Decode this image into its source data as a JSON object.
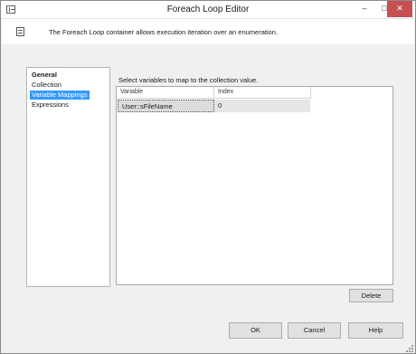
{
  "window": {
    "title": "Foreach Loop Editor",
    "minimize_glyph": "–",
    "maximize_glyph": "□",
    "close_glyph": "✕"
  },
  "header": {
    "description": "The Foreach Loop container allows execution iteration over an  enumeration."
  },
  "nav": {
    "items": [
      {
        "label": "General",
        "bold": true,
        "selected": false
      },
      {
        "label": "Collection",
        "bold": false,
        "selected": false
      },
      {
        "label": "Variable Mappings",
        "bold": false,
        "selected": true
      },
      {
        "label": "Expressions",
        "bold": false,
        "selected": false
      }
    ]
  },
  "main": {
    "instruction": "Select variables to map to the collection value.",
    "grid": {
      "columns": [
        "Variable",
        "Index"
      ],
      "rows": [
        [
          "User::sFileName",
          "0"
        ]
      ]
    },
    "delete_label": "Delete"
  },
  "footer": {
    "ok_label": "OK",
    "cancel_label": "Cancel",
    "help_label": "Help"
  },
  "colors": {
    "selection": "#3399ff",
    "close_button": "#c75050"
  }
}
